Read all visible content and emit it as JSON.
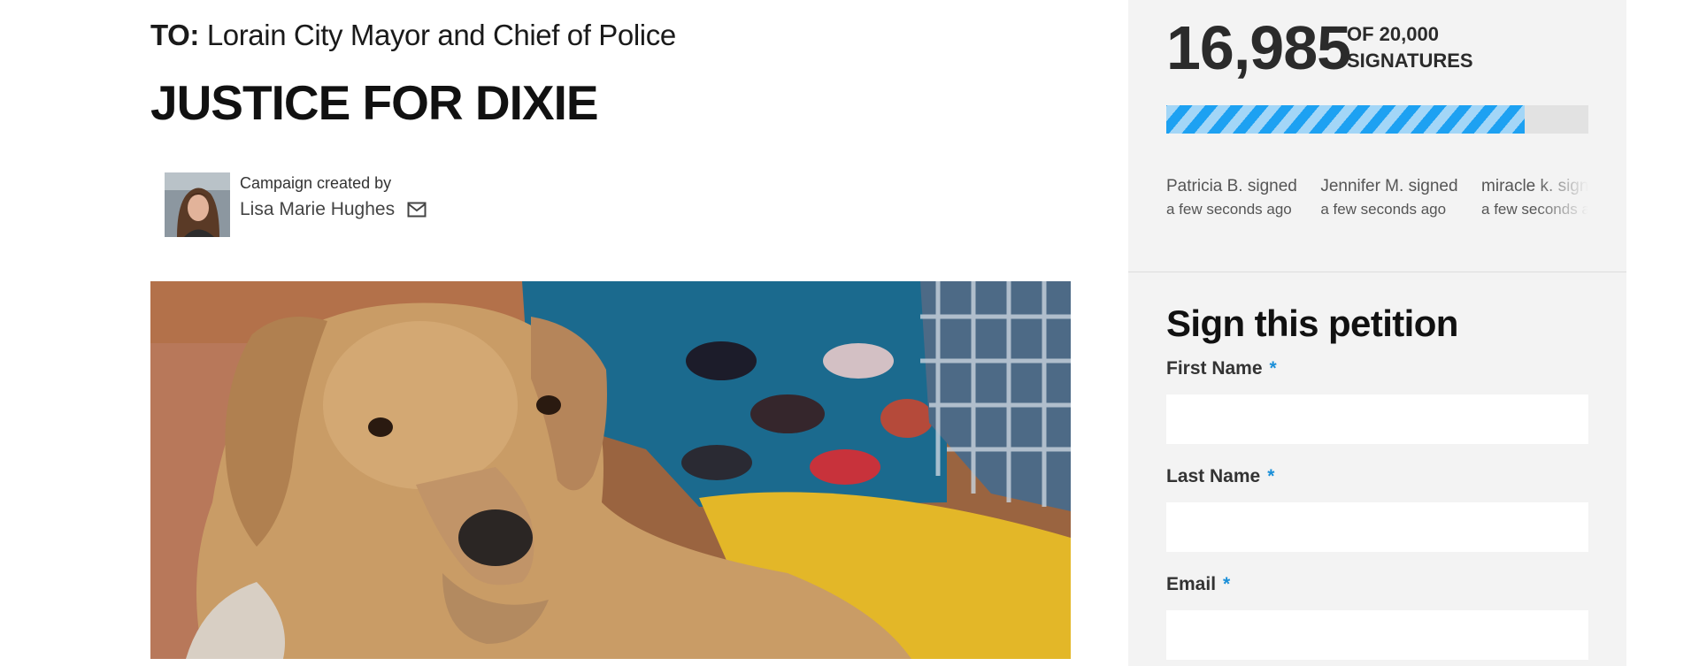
{
  "petition": {
    "target_prefix": "TO:",
    "target": "Lorain City Mayor and Chief of Police",
    "title": "JUSTICE FOR DIXIE",
    "creator_caption": "Campaign created by",
    "creator_name": "Lisa Marie Hughes"
  },
  "stats": {
    "signature_count": "16,985",
    "goal_text": "OF 20,000",
    "signatures_label": "SIGNATURES",
    "progress_fraction": 0.84925
  },
  "recent_signers": [
    {
      "name": "Patricia B. signed",
      "time": "a few seconds ago"
    },
    {
      "name": "Jennifer M. signed",
      "time": "a few seconds ago"
    },
    {
      "name": "miracle k. signed",
      "time": "a few seconds ago"
    }
  ],
  "form": {
    "title": "Sign this petition",
    "required_marker": "*",
    "fields": [
      {
        "label": "First Name",
        "value": ""
      },
      {
        "label": "Last Name",
        "value": ""
      },
      {
        "label": "Email",
        "value": ""
      }
    ]
  },
  "colors": {
    "accent": "#1da1f2",
    "required": "#1a8fd8",
    "sidebar_bg": "#f3f3f3"
  },
  "icons": {
    "creator_contact": "mail-icon"
  }
}
